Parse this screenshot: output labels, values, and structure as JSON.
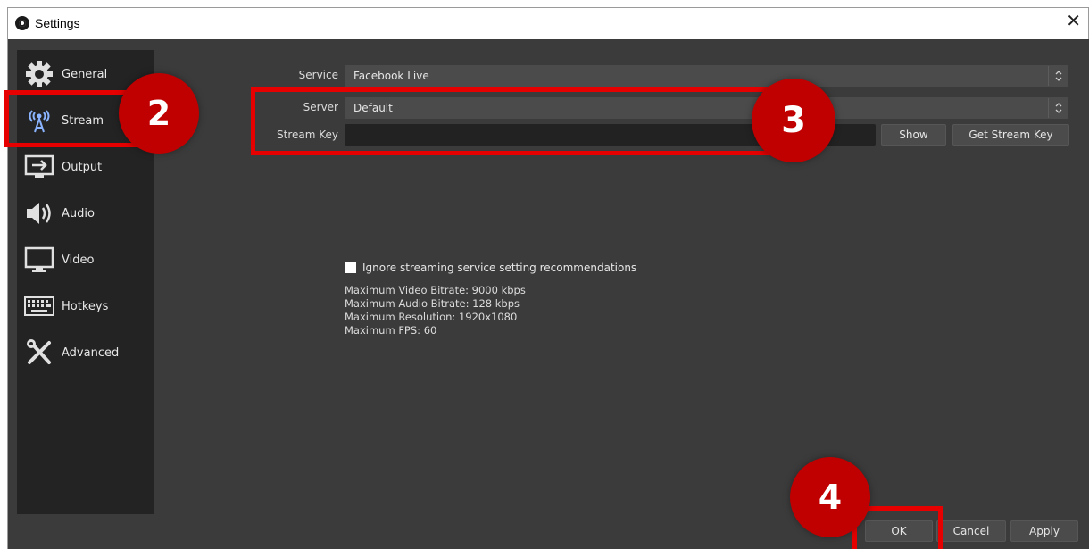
{
  "window": {
    "title": "Settings",
    "close_glyph": "✕"
  },
  "sidebar": {
    "items": [
      {
        "label": "General",
        "icon": "gear-icon"
      },
      {
        "label": "Stream",
        "icon": "broadcast-antenna-icon"
      },
      {
        "label": "Output",
        "icon": "output-monitor-icon"
      },
      {
        "label": "Audio",
        "icon": "speaker-icon"
      },
      {
        "label": "Video",
        "icon": "monitor-icon"
      },
      {
        "label": "Hotkeys",
        "icon": "keyboard-icon"
      },
      {
        "label": "Advanced",
        "icon": "tools-icon"
      }
    ],
    "selected": "Stream"
  },
  "stream": {
    "service_label": "Service",
    "service_value": "Facebook Live",
    "server_label": "Server",
    "server_value": "Default",
    "stream_key_label": "Stream Key",
    "stream_key_value": "",
    "show_button": "Show",
    "get_key_button": "Get Stream Key",
    "ignore_checkbox_label": "Ignore streaming service setting recommendations",
    "ignore_checked": false,
    "max_video_bitrate": "Maximum Video Bitrate: 9000 kbps",
    "max_audio_bitrate": "Maximum Audio Bitrate: 128 kbps",
    "max_resolution": "Maximum Resolution: 1920x1080",
    "max_fps": "Maximum FPS: 60"
  },
  "footer": {
    "ok": "OK",
    "cancel": "Cancel",
    "apply": "Apply"
  },
  "annotations": {
    "step2": "2",
    "step3": "3",
    "step4": "4"
  },
  "colors": {
    "accent": "#e60000",
    "badge": "#c00000",
    "panel": "#3b3b3b",
    "sidebar": "#232323"
  }
}
